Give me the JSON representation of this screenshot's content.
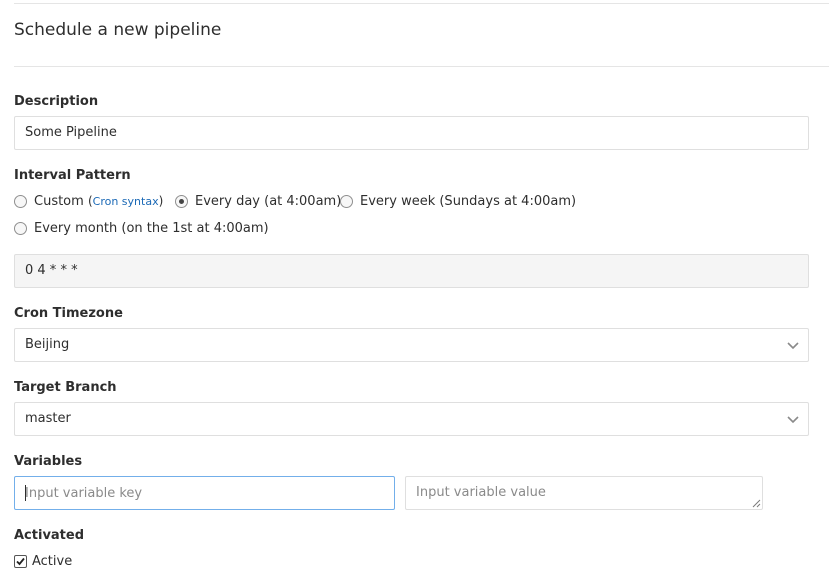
{
  "page": {
    "title": "Schedule a new pipeline"
  },
  "description": {
    "label": "Description",
    "value": "Some Pipeline"
  },
  "interval": {
    "label": "Interval Pattern",
    "options": [
      {
        "label": "Custom",
        "checked": false
      },
      {
        "label": "Every day (at 4:00am)",
        "checked": true
      },
      {
        "label": "Every week (Sundays at 4:00am)",
        "checked": false
      },
      {
        "label": "Every month (on the 1st at 4:00am)",
        "checked": false
      }
    ],
    "cron_link_open": "(",
    "cron_link_text": "Cron syntax",
    "cron_link_close": ")",
    "cron_value": "0 4 * * *"
  },
  "timezone": {
    "label": "Cron Timezone",
    "value": "Beijing"
  },
  "branch": {
    "label": "Target Branch",
    "value": "master"
  },
  "variables": {
    "label": "Variables",
    "key_placeholder": "Input variable key",
    "value_placeholder": "Input variable value"
  },
  "activated": {
    "label": "Activated",
    "checkbox_label": "Active",
    "checked": true
  }
}
